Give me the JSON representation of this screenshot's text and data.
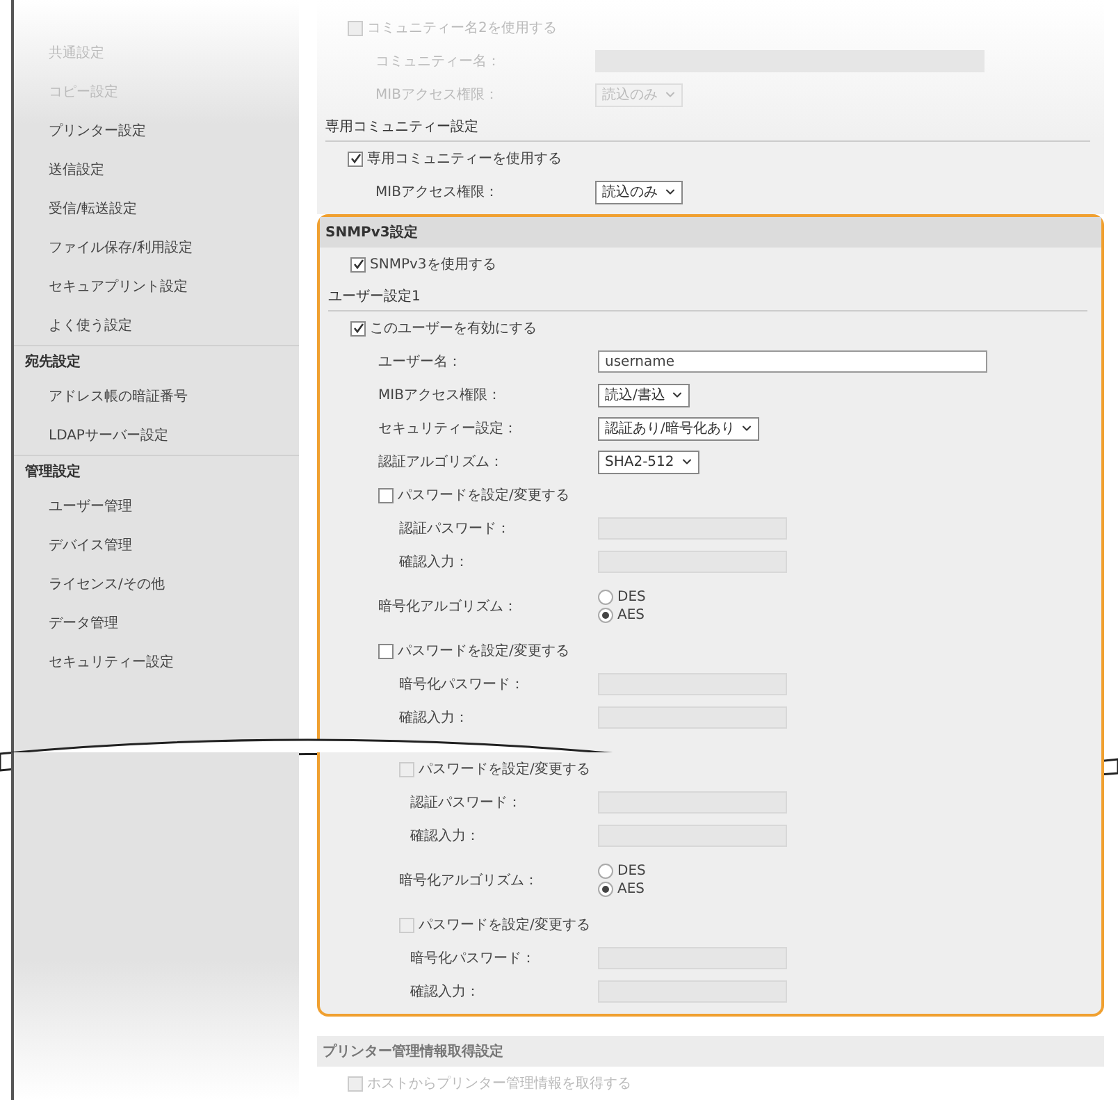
{
  "sidebar": {
    "items_top": [
      {
        "kind": "item",
        "label": "共通設定",
        "faded": true
      },
      {
        "kind": "item",
        "label": "コピー設定",
        "faded": true
      },
      {
        "kind": "item",
        "label": "プリンター設定",
        "faded": false
      },
      {
        "kind": "item",
        "label": "送信設定",
        "faded": false
      },
      {
        "kind": "item",
        "label": "受信/転送設定",
        "faded": false
      },
      {
        "kind": "item",
        "label": "ファイル保存/利用設定",
        "faded": false
      },
      {
        "kind": "item",
        "label": "セキュアプリント設定",
        "faded": false
      },
      {
        "kind": "item",
        "label": "よく使う設定",
        "faded": false
      },
      {
        "kind": "header",
        "label": "宛先設定",
        "faded": false
      },
      {
        "kind": "item",
        "label": "アドレス帳の暗証番号",
        "faded": false
      },
      {
        "kind": "item",
        "label": "LDAPサーバー設定",
        "faded": false
      },
      {
        "kind": "header",
        "label": "管理設定",
        "faded": false
      },
      {
        "kind": "item",
        "label": "ユーザー管理",
        "faded": false
      },
      {
        "kind": "item",
        "label": "デバイス管理",
        "faded": false
      },
      {
        "kind": "item",
        "label": "ライセンス/その他",
        "faded": false
      },
      {
        "kind": "item",
        "label": "データ管理",
        "faded": false
      },
      {
        "kind": "item",
        "label": "セキュリティー設定",
        "faded": false
      }
    ]
  },
  "top_rows": [
    {
      "kind": "checkbox",
      "label": "コミュニティー名2を使用する",
      "checked": false,
      "faded": true,
      "children": [
        {
          "kind": "field",
          "label": "コミュニティー名：",
          "faded": true
        },
        {
          "kind": "select",
          "label": "MIBアクセス権限：",
          "value": "読込のみ",
          "faded": true
        }
      ]
    },
    {
      "kind": "subheading",
      "label": "専用コミュニティー設定",
      "faded": false
    },
    {
      "kind": "checkbox",
      "label": "専用コミュニティーを使用する",
      "checked": true,
      "faded": false,
      "children": [
        {
          "kind": "select",
          "label": "MIBアクセス権限：",
          "value": "読込のみ",
          "faded": false
        }
      ]
    }
  ],
  "snmpv3": {
    "title": "SNMPv3設定",
    "rows": [
      {
        "kind": "checkbox",
        "label": "SNMPv3を使用する",
        "checked": true
      },
      {
        "kind": "subheading",
        "label": "ユーザー設定1"
      },
      {
        "kind": "checkbox",
        "label": "このユーザーを有効にする",
        "checked": true,
        "children": [
          {
            "kind": "field",
            "label": "ユーザー名：",
            "value": "username"
          },
          {
            "kind": "select",
            "label": "MIBアクセス権限：",
            "value": "読込/書込"
          },
          {
            "kind": "select",
            "label": "セキュリティー設定：",
            "value": "認証あり/暗号化あり"
          },
          {
            "kind": "select",
            "label": "認証アルゴリズム：",
            "value": "SHA2-512"
          },
          {
            "kind": "checkbox",
            "label": "パスワードを設定/変更する",
            "checked": false,
            "children": [
              {
                "kind": "field",
                "label": "認証パスワード："
              },
              {
                "kind": "field",
                "label": "確認入力："
              }
            ]
          },
          {
            "kind": "radio",
            "label": "暗号化アルゴリズム：",
            "options": [
              {
                "label": "DES",
                "selected": false
              },
              {
                "label": "AES",
                "selected": true
              }
            ]
          },
          {
            "kind": "checkbox",
            "label": "パスワードを設定/変更する",
            "checked": false,
            "children": [
              {
                "kind": "field",
                "label": "暗号化パスワード："
              },
              {
                "kind": "field",
                "label": "確認入力："
              }
            ]
          }
        ]
      }
    ],
    "after_break": [
      {
        "kind": "checkbox",
        "label": "パスワードを設定/変更する",
        "checked": false,
        "disabled": true,
        "children": [
          {
            "kind": "field",
            "label": "認証パスワード："
          },
          {
            "kind": "field",
            "label": "確認入力："
          }
        ]
      },
      {
        "kind": "radio",
        "label": "暗号化アルゴリズム：",
        "options": [
          {
            "label": "DES",
            "selected": false
          },
          {
            "label": "AES",
            "selected": true
          }
        ]
      },
      {
        "kind": "checkbox",
        "label": "パスワードを設定/変更する",
        "checked": false,
        "disabled": true,
        "children": [
          {
            "kind": "field",
            "label": "暗号化パスワード："
          },
          {
            "kind": "field",
            "label": "確認入力："
          }
        ]
      }
    ]
  },
  "printer_info": {
    "title": "プリンター管理情報取得設定",
    "rows": [
      {
        "kind": "checkbox",
        "label": "ホストからプリンター管理情報を取得する",
        "checked": false,
        "faded": true
      }
    ]
  }
}
